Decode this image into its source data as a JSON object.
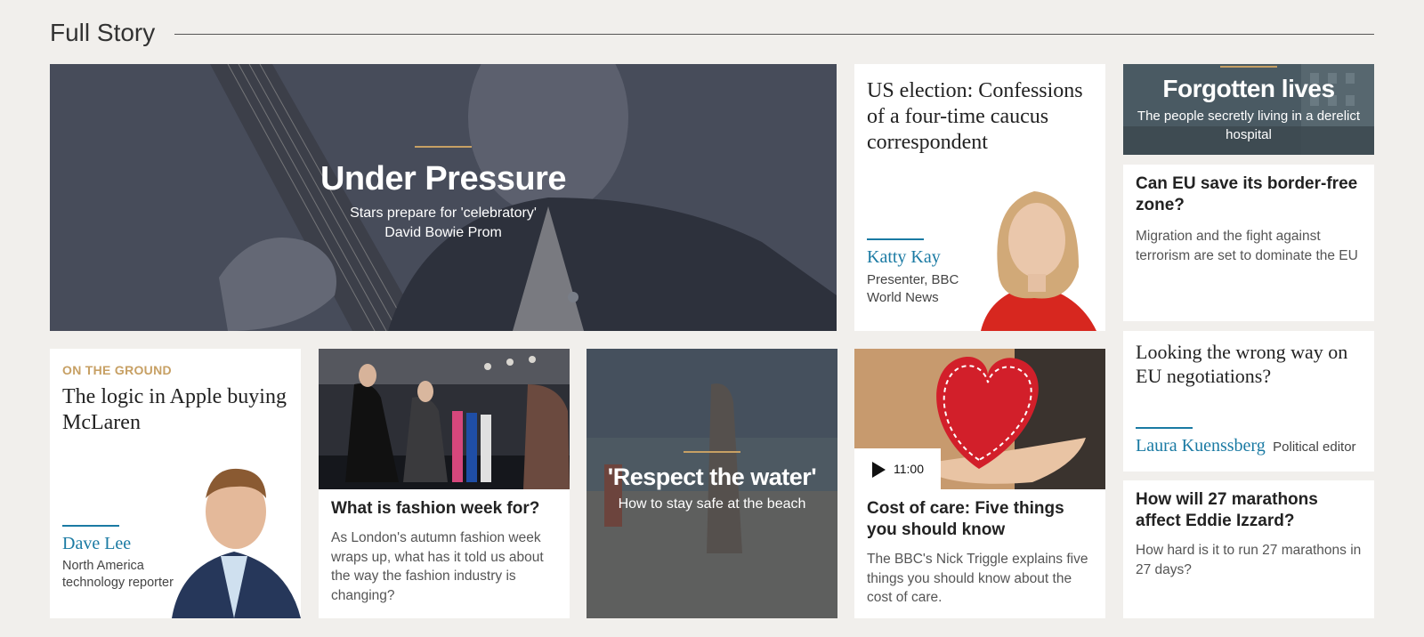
{
  "section": {
    "title": "Full Story"
  },
  "hero": {
    "title": "Under Pressure",
    "subtitle_line1": "Stars prepare for 'celebratory'",
    "subtitle_line2": "David Bowie Prom"
  },
  "katty": {
    "headline": "US election: Confessions of a four-time caucus correspondent",
    "author": "Katty Kay",
    "role": "Presenter, BBC World News"
  },
  "forgotten": {
    "title": "Forgotten lives",
    "subtitle": "The people secretly living in a derelict hospital"
  },
  "eu_border": {
    "headline": "Can EU save its border-free zone?",
    "summary": "Migration and the fight against terrorism are set to dominate the EU"
  },
  "eu_wrong": {
    "headline": "Looking the wrong way on EU negotiations?",
    "author": "Laura Kuenssberg",
    "role": "Political editor"
  },
  "eddie": {
    "headline": "How will 27 marathons affect Eddie Izzard?",
    "summary": "How hard is it to run 27 marathons in 27 days?"
  },
  "apple": {
    "kicker": "ON THE GROUND",
    "headline": "The logic in Apple buying McLaren",
    "author": "Dave Lee",
    "role": "North America technology reporter"
  },
  "fashion": {
    "headline": "What is fashion week for?",
    "summary": "As London's autumn fashion week wraps up, what has it told us about the way the fashion industry is changing?"
  },
  "water": {
    "title": "'Respect the water'",
    "subtitle": "How to stay safe at the beach"
  },
  "care": {
    "duration": "11:00",
    "headline": "Cost of care: Five things you should know",
    "summary": "The BBC's Nick Triggle explains five things you should know about the cost of care."
  },
  "colors": {
    "accent_gold": "#c7a064",
    "author_blue": "#1a7aa3",
    "page_bg": "#f1efec"
  },
  "icons": {
    "play": "play-icon"
  }
}
